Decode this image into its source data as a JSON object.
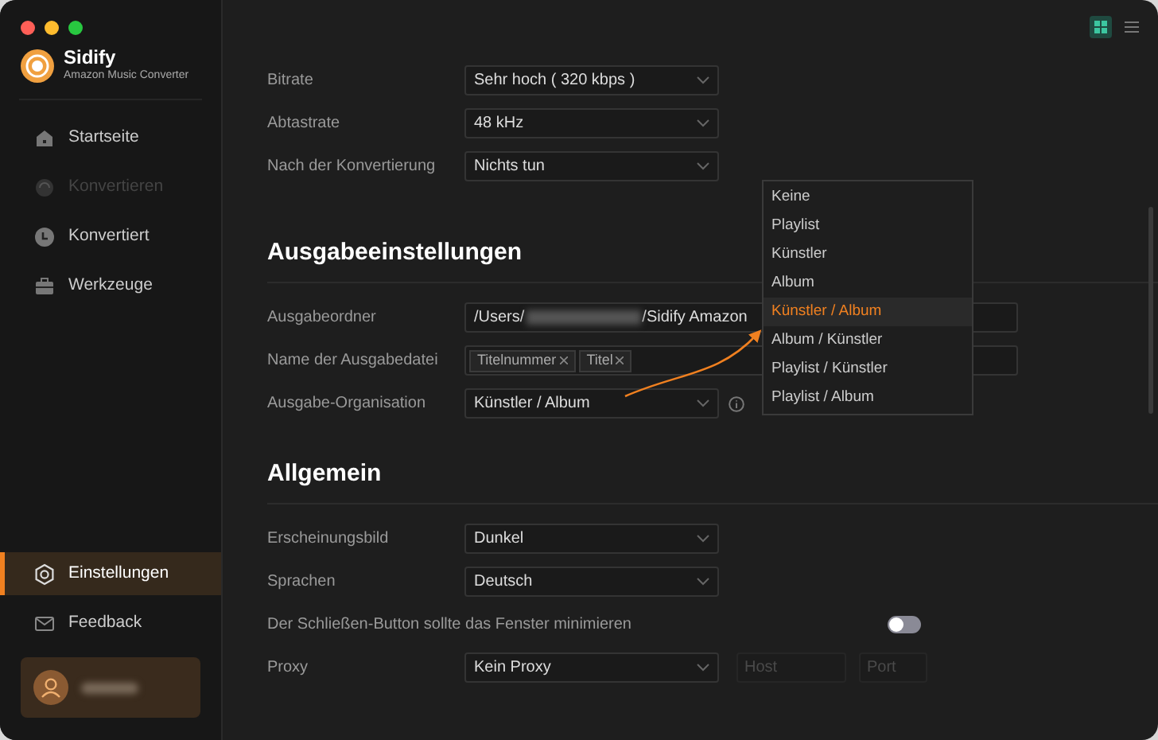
{
  "sidebar": {
    "app_name": "Sidify",
    "app_subtitle": "Amazon Music Converter",
    "nav": [
      {
        "label": "Startseite",
        "selected": false,
        "disabled": false
      },
      {
        "label": "Konvertieren",
        "selected": false,
        "disabled": true
      },
      {
        "label": "Konvertiert",
        "selected": false,
        "disabled": false
      },
      {
        "label": "Werkzeuge",
        "selected": false,
        "disabled": false
      }
    ],
    "footer": [
      {
        "label": "Einstellungen",
        "selected": true
      },
      {
        "label": "Feedback",
        "selected": false
      }
    ]
  },
  "sections": [
    {
      "rows": [
        {
          "kind": "select",
          "label": "Bitrate",
          "value": "Sehr hoch ( 320 kbps )"
        },
        {
          "kind": "select",
          "label": "Abtastrate",
          "value": "48 kHz"
        },
        {
          "kind": "select",
          "label": "Nach der Konvertierung",
          "value": "Nichts tun"
        }
      ]
    },
    {
      "title": "Ausgabeeinstellungen",
      "rows": [
        {
          "kind": "path",
          "label": "Ausgabeordner",
          "prefix": "/Users/",
          "suffix": "/Sidify Amazon"
        },
        {
          "kind": "tags",
          "label": "Name der Ausgabedatei",
          "tags": [
            "Titelnummer",
            "Titel"
          ]
        },
        {
          "kind": "infoselect",
          "label": "Ausgabe-Organisation",
          "value": "Künstler  /  Album"
        }
      ]
    },
    {
      "title": "Allgemein",
      "rows": [
        {
          "kind": "select",
          "label": "Erscheinungsbild",
          "value": "Dunkel"
        },
        {
          "kind": "select",
          "label": "Sprachen",
          "value": "Deutsch"
        },
        {
          "kind": "toggle",
          "label": "Der Schließen-Button sollte das Fenster minimieren",
          "on": false
        },
        {
          "kind": "proxy",
          "label": "Proxy",
          "value": "Kein Proxy",
          "host_placeholder": "Host",
          "port_placeholder": "Port"
        }
      ]
    }
  ],
  "dropdown": [
    {
      "label": "Keine",
      "selected": false
    },
    {
      "label": "Playlist",
      "selected": false
    },
    {
      "label": "Künstler",
      "selected": false
    },
    {
      "label": "Album",
      "selected": false
    },
    {
      "label": "Künstler / Album",
      "selected": true
    },
    {
      "label": "Album / Künstler",
      "selected": false
    },
    {
      "label": "Playlist / Künstler",
      "selected": false
    },
    {
      "label": "Playlist / Album",
      "selected": false
    }
  ]
}
